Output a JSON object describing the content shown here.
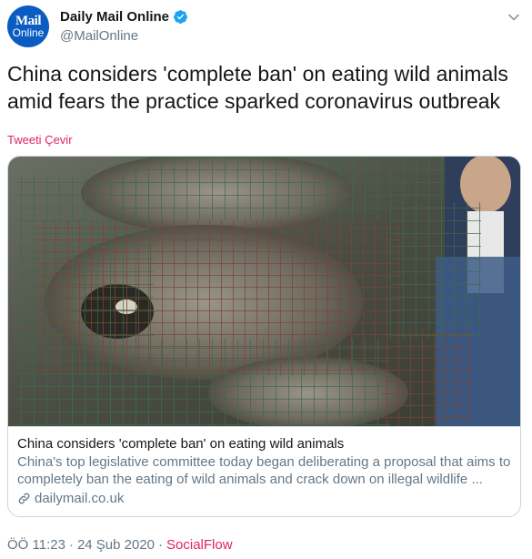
{
  "author": {
    "avatar_line1": "Mail",
    "avatar_line2": "Online",
    "display_name": "Daily Mail Online",
    "handle": "@MailOnline"
  },
  "tweet": {
    "text": "China considers 'complete ban' on eating wild animals amid fears the practice sparked coronavirus outbreak",
    "translate_label": "Tweeti Çevir"
  },
  "card": {
    "title": "China considers 'complete ban' on eating wild animals",
    "description": "China's top legislative committee today began deliberating a proposal that aims to completely ban the eating of wild animals and crack down on illegal wildlife ...",
    "domain": "dailymail.co.uk"
  },
  "meta": {
    "time": "ÖÖ 11:23",
    "separator": "·",
    "date": "24 Şub 2020",
    "source": "SocialFlow"
  },
  "colors": {
    "link": "#e0245e",
    "secondary": "#657786",
    "verified": "#1da1f2",
    "brand": "#0a5cc2"
  }
}
